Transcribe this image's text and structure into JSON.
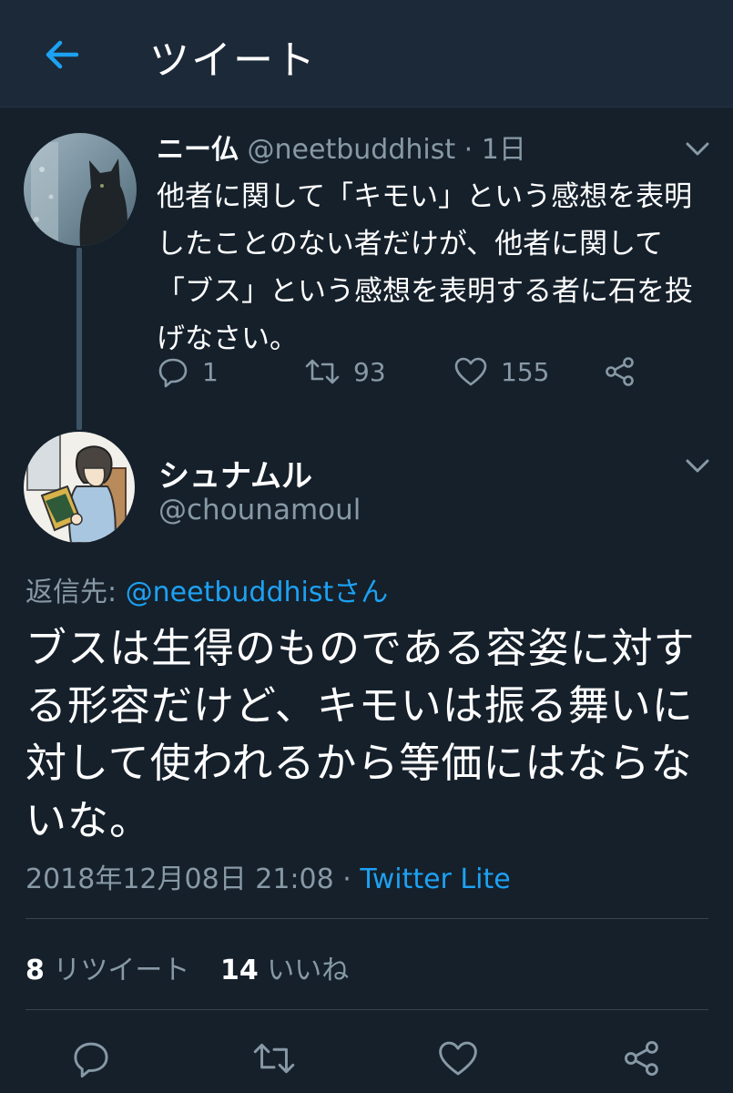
{
  "header": {
    "title": "ツイート",
    "back_icon": "back-arrow-icon"
  },
  "parent_tweet": {
    "name": "ニー仏",
    "handle": "@neetbuddhist",
    "separator": "·",
    "time": "1日",
    "text": "他者に関して「キモい」という感想を表明したことのない者だけが、他者に関して「ブス」という感想を表明する者に石を投げなさい。",
    "actions": {
      "replies": "1",
      "retweets": "93",
      "likes": "155"
    }
  },
  "reply_tweet": {
    "name": "シュナムル",
    "handle": "@chounamoul",
    "reply_to_label": "返信先:",
    "reply_to_handle": "@neetbuddhistさん",
    "text": "ブスは生得のものである容姿に対する形容だけど、キモいは振る舞いに対して使われるから等価にはならないな。",
    "timestamp": "2018年12月08日 21:08",
    "separator": "·",
    "client": "Twitter Lite",
    "retweet_count": "8",
    "retweet_label": "リツイート",
    "like_count": "14",
    "like_label": "いいね"
  },
  "colors": {
    "background": "#15202b",
    "header": "#1c2938",
    "accent": "#1da1f2",
    "muted": "#8899a6",
    "divider": "#38444d"
  }
}
